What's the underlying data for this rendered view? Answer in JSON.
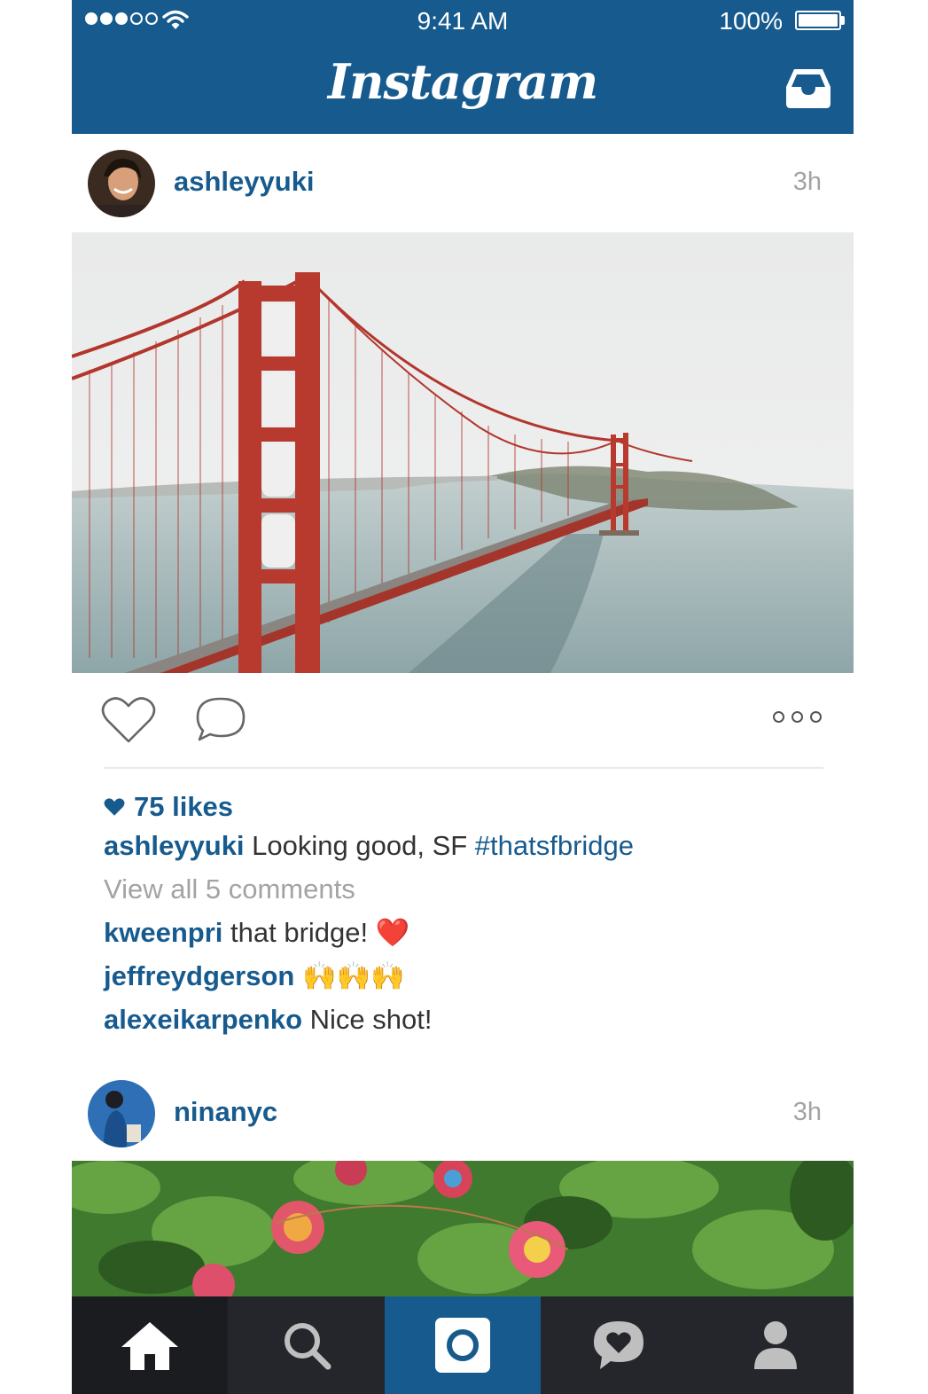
{
  "status_bar": {
    "time": "9:41 AM",
    "battery": "100%"
  },
  "header": {
    "title": "Instagram",
    "inbox_icon": "inbox-icon"
  },
  "posts": [
    {
      "username": "ashleyyuki",
      "age": "3h",
      "likes": "75 likes",
      "caption_user": "ashleyyuki",
      "caption_text": "Looking good, SF ",
      "caption_tag": "#thatsfbridge",
      "view_comments": "View all 5 comments",
      "comments": [
        {
          "user": "kweenpri",
          "text": "that bridge! ",
          "emoji": "❤️"
        },
        {
          "user": "jeffreydgerson",
          "text": "",
          "emoji": "🙌🙌🙌"
        },
        {
          "user": "alexeikarpenko",
          "text": "Nice shot!",
          "emoji": ""
        }
      ]
    },
    {
      "username": "ninanyc",
      "age": "3h"
    }
  ],
  "nav": [
    "home-icon",
    "search-icon",
    "camera-icon",
    "activity-icon",
    "profile-icon"
  ],
  "colors": {
    "brand": "#175b8e",
    "nav_dark": "#24262b"
  }
}
